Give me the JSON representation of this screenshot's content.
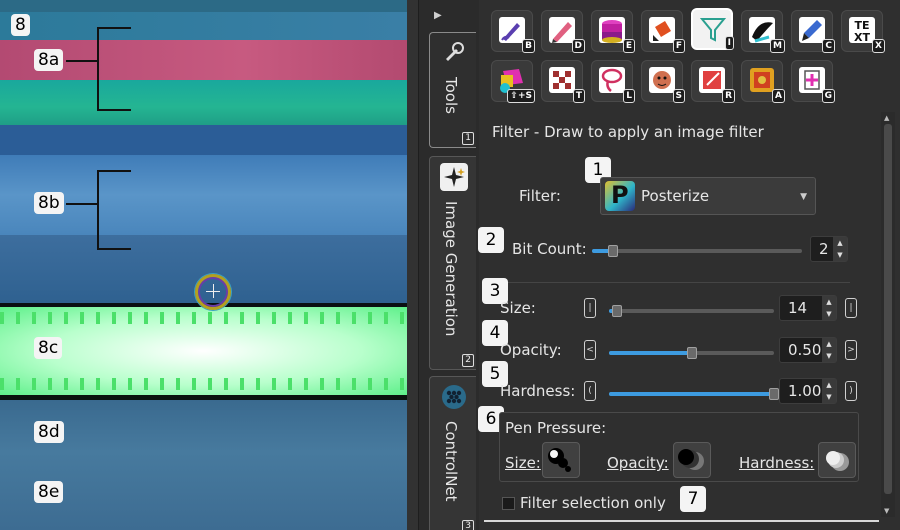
{
  "canvas": {
    "labels": {
      "l8": "8",
      "l8a": "8a",
      "l8b": "8b",
      "l8c": "8c",
      "l8d": "8d",
      "l8e": "8e"
    },
    "colors": {
      "pink_band": "#c75a80",
      "green_band": "#24b592",
      "glow": "#b8ffcc"
    }
  },
  "side_tabs": [
    {
      "label": "Tools",
      "num": "1",
      "icon": "tools-icon"
    },
    {
      "label": "Image Generation",
      "num": "2",
      "icon": "sparkle-icon"
    },
    {
      "label": "ControlNet",
      "num": "3",
      "icon": "controlnet-icon"
    }
  ],
  "tools": [
    {
      "name": "freehand-brush",
      "key": "B"
    },
    {
      "name": "line",
      "key": "D"
    },
    {
      "name": "fill-layer",
      "key": "E"
    },
    {
      "name": "paint-bucket",
      "key": "F"
    },
    {
      "name": "filter",
      "key": "I",
      "selected": true
    },
    {
      "name": "smudge",
      "key": "M"
    },
    {
      "name": "color-picker",
      "key": "C"
    },
    {
      "name": "text",
      "key": "X",
      "glyph": "TEXT"
    },
    {
      "name": "shape",
      "key": "⇧+S"
    },
    {
      "name": "transform",
      "key": "T"
    },
    {
      "name": "lasso",
      "key": "L"
    },
    {
      "name": "selection",
      "key": "S"
    },
    {
      "name": "rect-select",
      "key": "R"
    },
    {
      "name": "auto-select",
      "key": "A"
    },
    {
      "name": "generate",
      "key": "G"
    }
  ],
  "filter_panel": {
    "title": "Filter - Draw to apply an image filter",
    "filter_label": "Filter:",
    "filter_value": "Posterize",
    "bitcount_label": "Bit Count:",
    "bitcount_value": "2",
    "bitcount_level": 0.1,
    "size_label": "Size:",
    "size_value": "14",
    "size_level": 0.05,
    "opacity_label": "Opacity:",
    "opacity_value": "0.50",
    "opacity_level": 0.5,
    "hardness_label": "Hardness:",
    "hardness_value": "1.00",
    "hardness_level": 1.0,
    "pressure_title": "Pen Pressure:",
    "pressure_size": "Size:",
    "pressure_opacity": "Opacity:",
    "pressure_hardness": "Hardness:",
    "selection_only": "Filter selection only"
  },
  "callouts": {
    "c1": "1",
    "c2": "2",
    "c3": "3",
    "c4": "4",
    "c5": "5",
    "c6": "6",
    "c7": "7"
  },
  "accent": "#3d9be0"
}
